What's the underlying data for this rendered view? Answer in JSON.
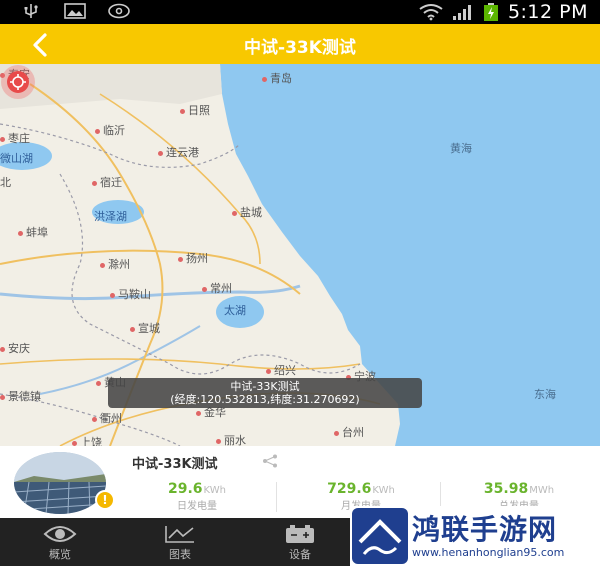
{
  "status_bar": {
    "time": "5:12 PM",
    "icons": [
      "usb-icon",
      "image-icon",
      "voicemail-icon",
      "wifi-icon",
      "signal-icon",
      "battery-charging-icon"
    ]
  },
  "header": {
    "title": "中试-33K测试",
    "back_icon": "chevron-left-icon"
  },
  "map": {
    "places": [
      "泰安",
      "青岛",
      "日照",
      "临沂",
      "枣庄",
      "连云港",
      "微山湖",
      "宿迁",
      "北",
      "盐城",
      "洪泽湖",
      "蚌埠",
      "滁州",
      "扬州",
      "马鞍山",
      "常州",
      "宣城",
      "安庆",
      "绍兴",
      "宁波",
      "黄山",
      "金华",
      "衢州",
      "丽水",
      "台州",
      "上饶",
      "景德镇"
    ],
    "seas": [
      "黄海",
      "东海"
    ],
    "lakes": [
      "太湖"
    ],
    "marker_icon": "location-pin-icon",
    "tooltip": {
      "name": "中试-33K测试",
      "coords": "(经度:120.532813,纬度:31.270692)"
    }
  },
  "station": {
    "name": "中试-33K测试",
    "warning": "!",
    "share_icon": "share-icon",
    "metrics": [
      {
        "value": "29.6",
        "unit": "KWh",
        "label": "日发电量"
      },
      {
        "value": "729.6",
        "unit": "KWh",
        "label": "月发电量"
      },
      {
        "value": "35.98",
        "unit": "MWh",
        "label": "总发电量"
      }
    ]
  },
  "tabs": [
    {
      "label": "概览",
      "icon": "eye-icon"
    },
    {
      "label": "图表",
      "icon": "chart-icon"
    },
    {
      "label": "设备",
      "icon": "battery-icon"
    }
  ],
  "watermark": {
    "title": "鸿联手游网",
    "url": "www.henanhonglian95.com"
  },
  "colors": {
    "accent": "#f8c800",
    "metric_green": "#6ab42d",
    "sea": "#8fc8f0",
    "tab_bar": "#222222"
  }
}
